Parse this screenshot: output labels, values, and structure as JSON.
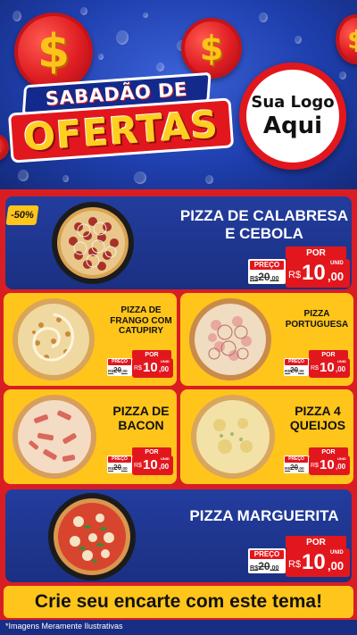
{
  "header": {
    "title_top": "SABADÃO DE",
    "title_main": "OFERTAS",
    "logo_line1": "Sua Logo",
    "logo_line2": "Aqui",
    "coin_symbol": "$"
  },
  "discount_badge": "-50%",
  "price_labels": {
    "por": "POR",
    "preco": "PREÇO",
    "currency": "R$",
    "unit": "UNID",
    "old_price_int": "20",
    "old_price_dec": ",00",
    "old_prefix": "R$",
    "new_price_int": "10",
    "new_price_dec": ",00"
  },
  "products": [
    {
      "name_line1": "PIZZA DE CALABRESA",
      "name_line2": "E CEBOLA"
    },
    {
      "name_line1": "PIZZA DE",
      "name_line2": "FRANGO COM",
      "name_line3": "CATUPIRY"
    },
    {
      "name_line1": "PIZZA",
      "name_line2": "PORTUGUESA"
    },
    {
      "name_line1": "PIZZA DE",
      "name_line2": "BACON"
    },
    {
      "name_line1": "PIZZA 4",
      "name_line2": "QUEIJOS"
    },
    {
      "name_line1": "PIZZA MARGUERITA"
    }
  ],
  "cta": "Crie seu encarte com este tema!",
  "footer": "*Imagens Meramente Ilustrativas",
  "colors": {
    "red": "#e2171d",
    "yellow": "#ffc51a",
    "blue": "#1f3fae",
    "dark_blue": "#1b3082"
  }
}
